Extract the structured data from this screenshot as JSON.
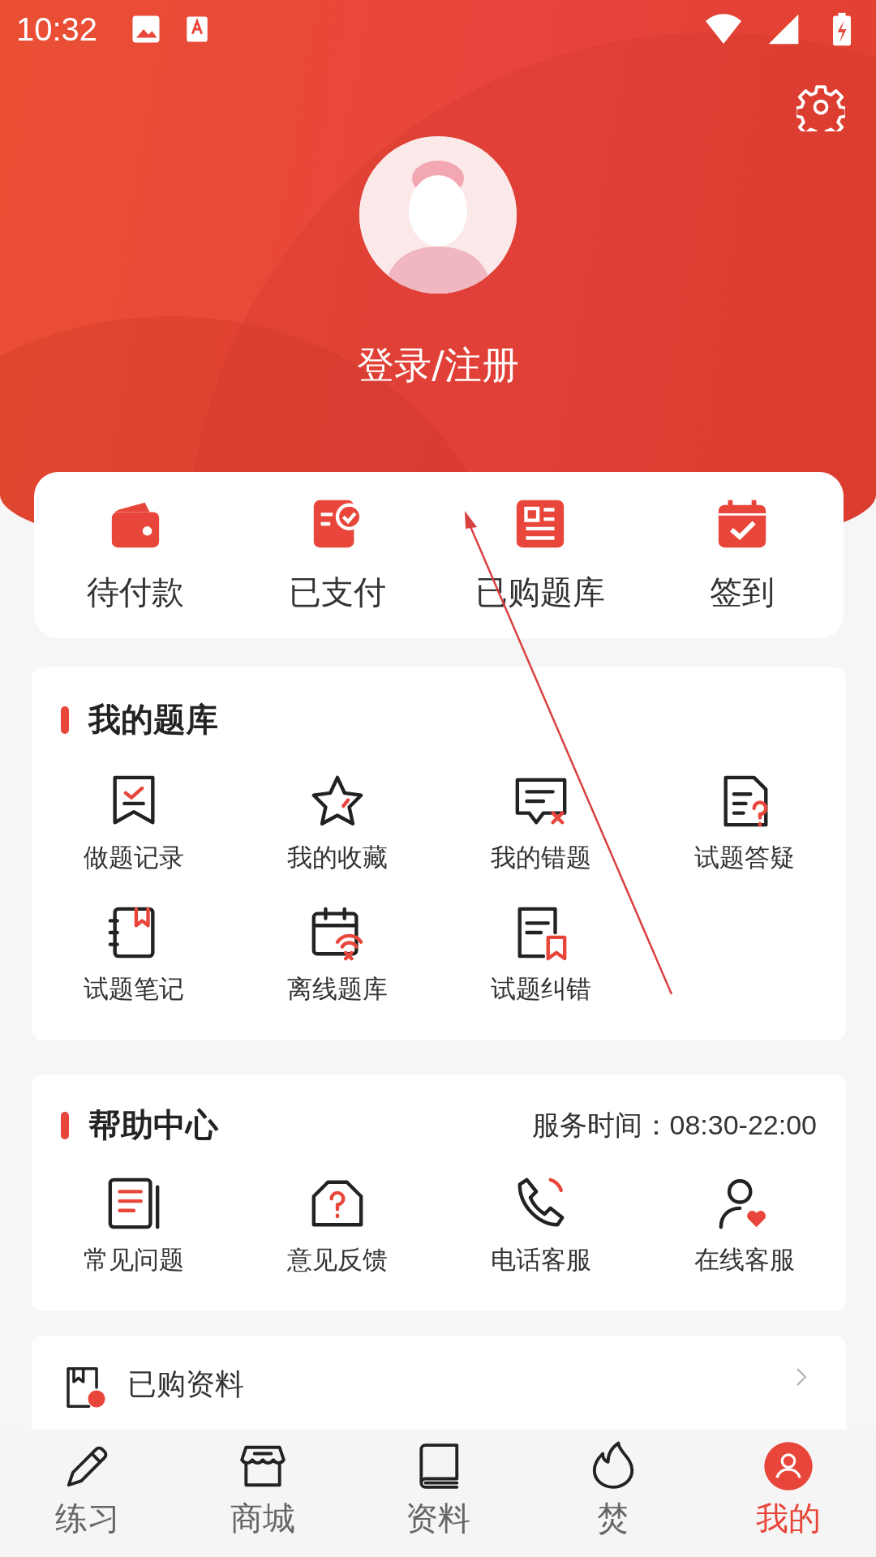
{
  "status_bar": {
    "time": "10:32"
  },
  "profile": {
    "login_label": "登录/注册"
  },
  "orders": [
    {
      "label": "待付款"
    },
    {
      "label": "已支付"
    },
    {
      "label": "已购题库"
    },
    {
      "label": "签到"
    }
  ],
  "question_bank": {
    "title": "我的题库",
    "items": [
      {
        "label": "做题记录"
      },
      {
        "label": "我的收藏"
      },
      {
        "label": "我的错题"
      },
      {
        "label": "试题答疑"
      },
      {
        "label": "试题笔记"
      },
      {
        "label": "离线题库"
      },
      {
        "label": "试题纠错"
      }
    ]
  },
  "help_center": {
    "title": "帮助中心",
    "service_hours": "服务时间：08:30-22:00",
    "items": [
      {
        "label": "常见问题"
      },
      {
        "label": "意见反馈"
      },
      {
        "label": "电话客服"
      },
      {
        "label": "在线客服"
      }
    ]
  },
  "purchased_materials": {
    "label": "已购资料"
  },
  "bottom_nav": [
    {
      "label": "练习",
      "selected": false
    },
    {
      "label": "商城",
      "selected": false
    },
    {
      "label": "资料",
      "selected": false
    },
    {
      "label": "焚",
      "selected": false
    },
    {
      "label": "我的",
      "selected": true
    }
  ]
}
